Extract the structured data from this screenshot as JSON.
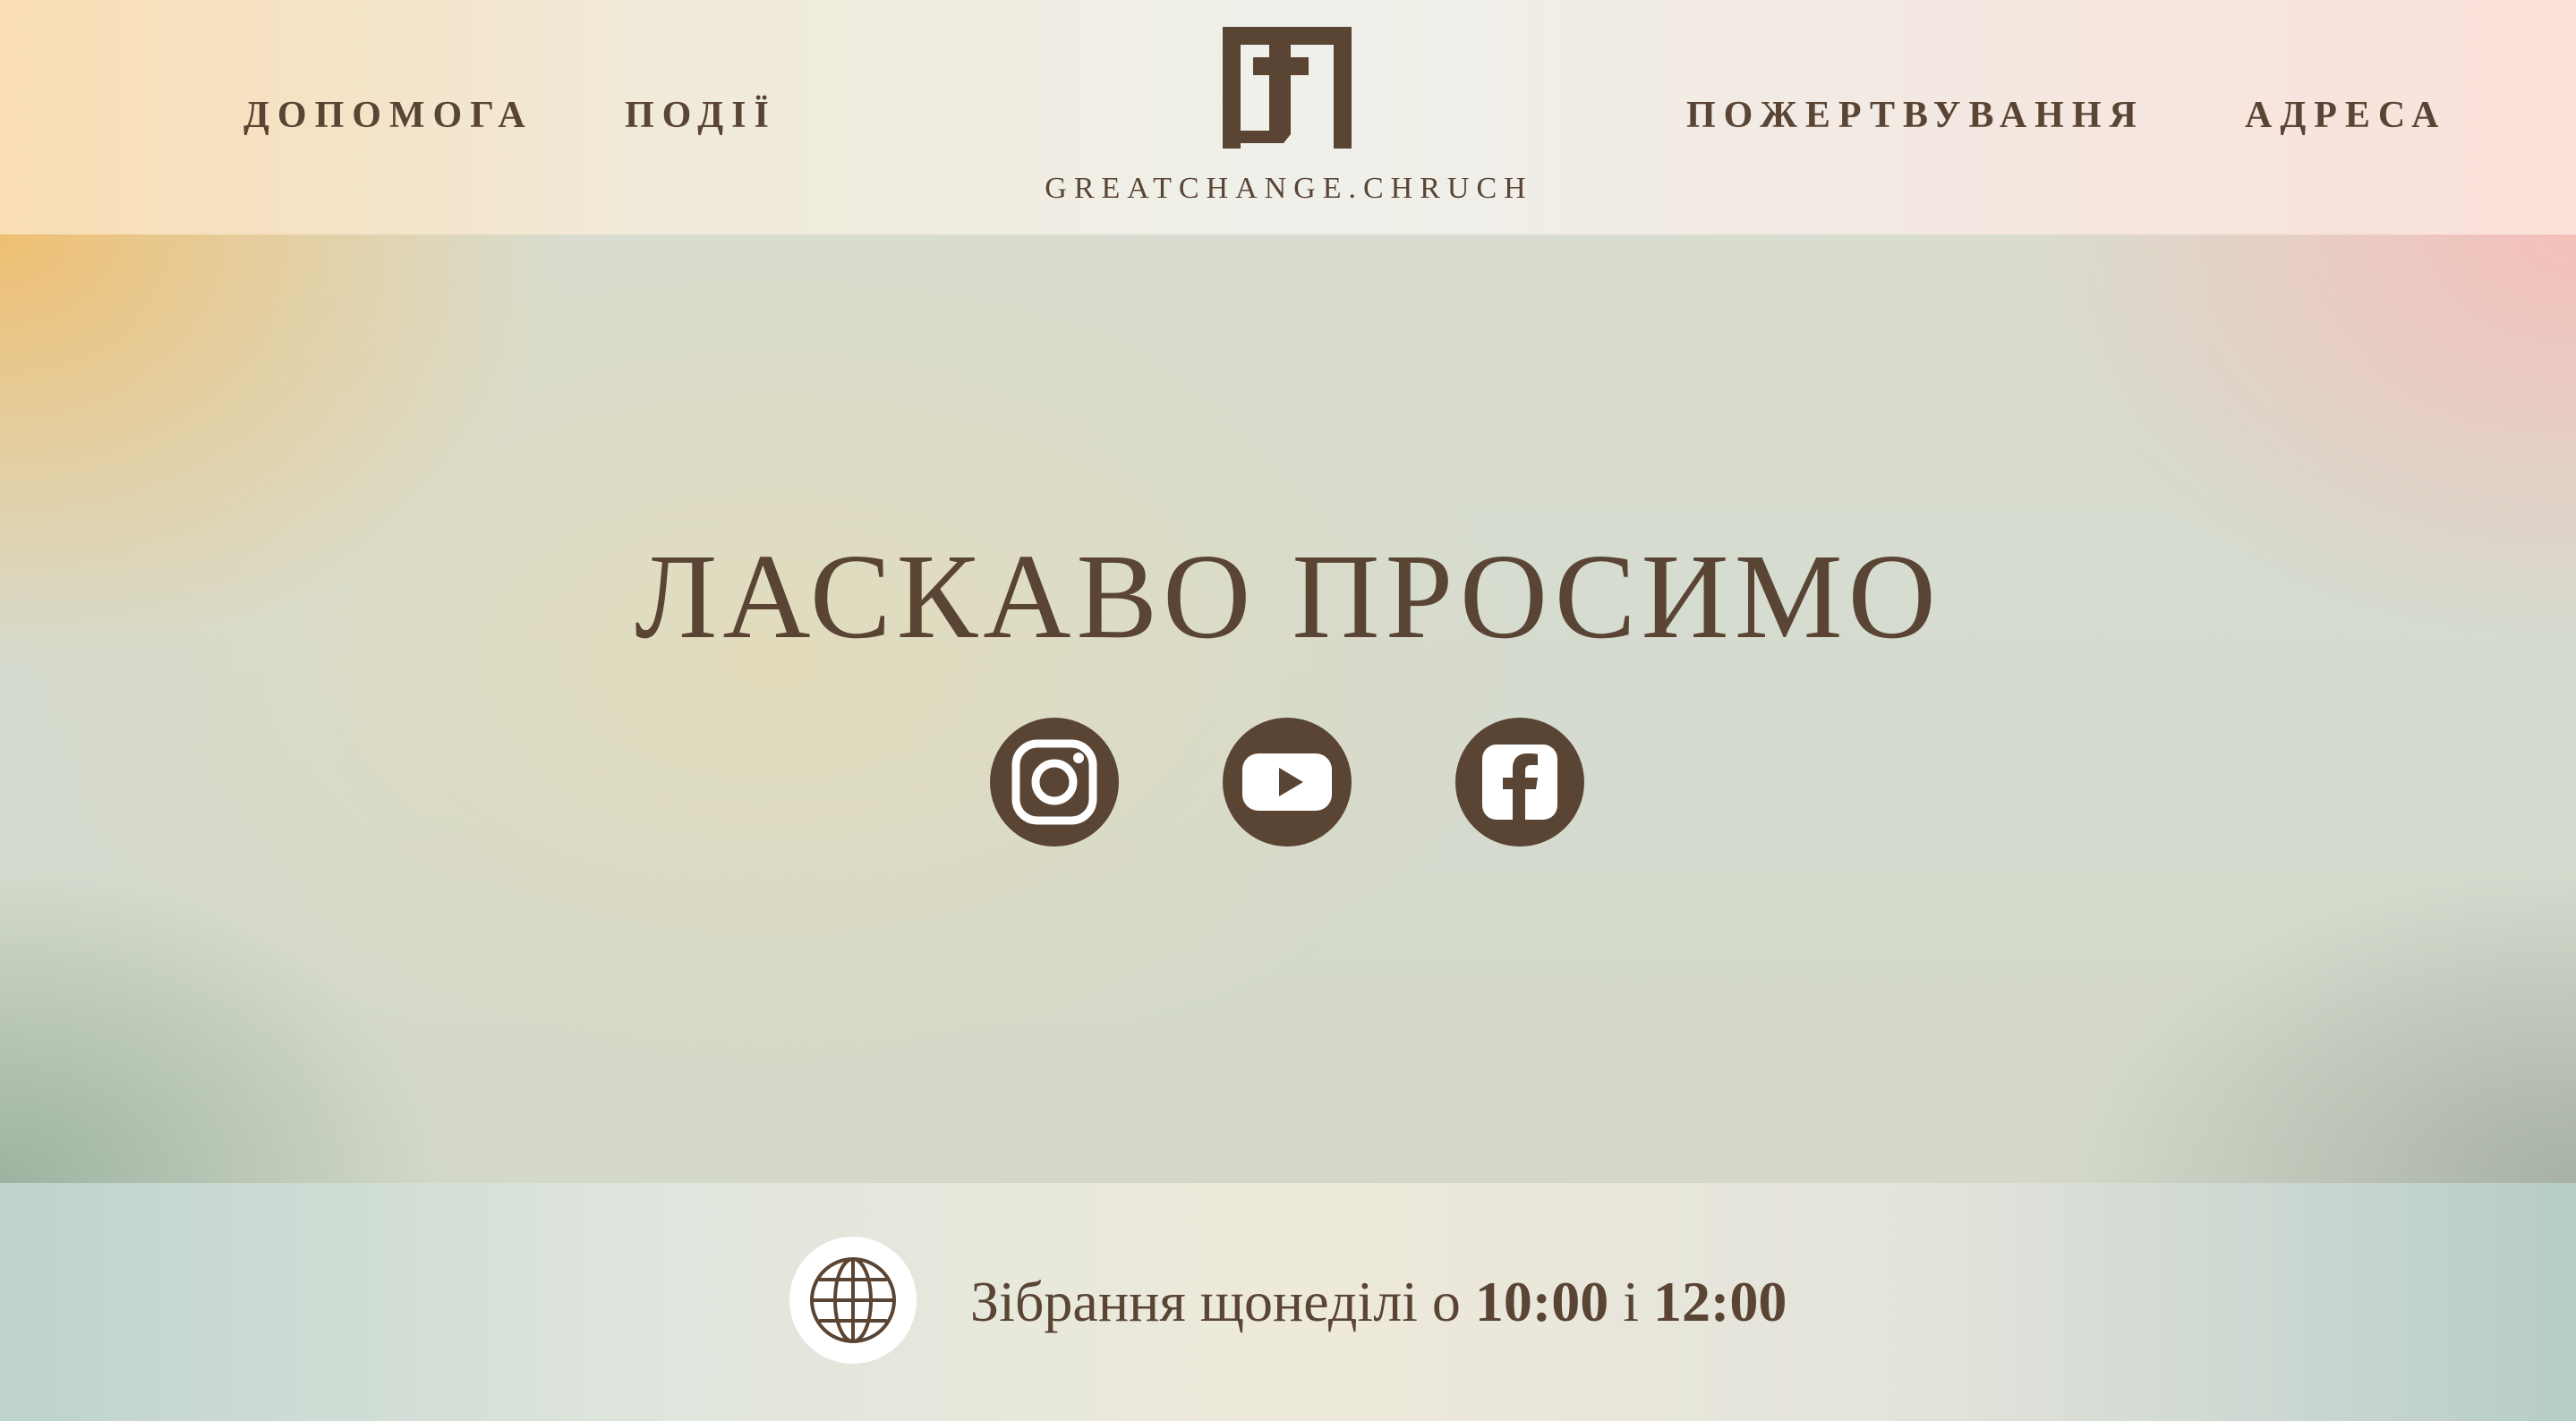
{
  "header": {
    "nav_left": [
      {
        "label": "ДОПОМОГА"
      },
      {
        "label": "ПОДІЇ"
      }
    ],
    "nav_right": [
      {
        "label": "ПОЖЕРТВУВАННЯ"
      },
      {
        "label": "АДРЕСА"
      }
    ],
    "logo_text": "GREATCHANGE.CHRUCH"
  },
  "hero": {
    "title": "ЛАСКАВО ПРОСИМО",
    "social": [
      {
        "icon": "instagram-icon"
      },
      {
        "icon": "youtube-icon"
      },
      {
        "icon": "facebook-icon"
      }
    ]
  },
  "footer": {
    "icon": "globe-icon",
    "schedule_prefix": "Зібрання щонеділі о",
    "time_1": "10:00",
    "conjunction": "і",
    "time_2": "12:00"
  },
  "colors": {
    "text": "#5a4535",
    "icon_fill": "#5a4535",
    "badge_bg": "#ffffff"
  }
}
